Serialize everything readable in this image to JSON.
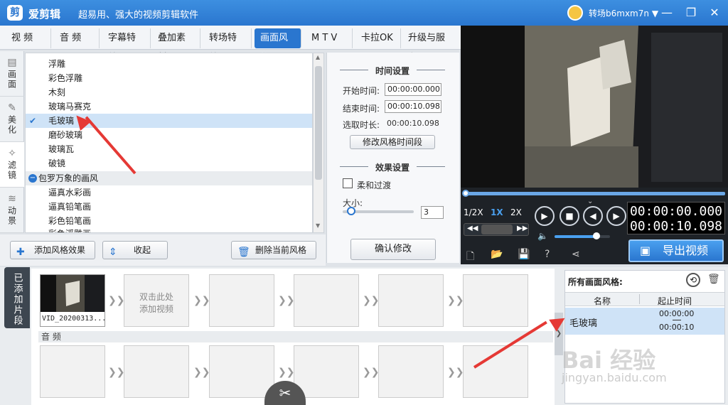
{
  "titlebar": {
    "app_name": "爱剪辑",
    "logo": "剪",
    "slogan": "超易用、强大的视频剪辑软件",
    "user_name": "转场b6mxm7n",
    "chevron": "▼"
  },
  "tabs": [
    {
      "label": "视 频"
    },
    {
      "label": "音 频"
    },
    {
      "label": "字幕特效"
    },
    {
      "label": "叠加素材"
    },
    {
      "label": "转场特效"
    },
    {
      "label": "画面风格"
    },
    {
      "label": "M T V"
    },
    {
      "label": "卡拉OK"
    },
    {
      "label": "升级与服务"
    }
  ],
  "side_tabs": [
    {
      "label": "画面"
    },
    {
      "label": "美化"
    },
    {
      "label": "滤镜"
    },
    {
      "label": "动景"
    }
  ],
  "filter_items": [
    "浮雕",
    "彩色浮雕",
    "木刻",
    "玻璃马赛克",
    "毛玻璃",
    "磨砂玻璃",
    "玻璃瓦",
    "破镜"
  ],
  "filter_group": "包罗万象的画风",
  "group_items": [
    "逼真水彩画",
    "逼真铅笔画",
    "彩色铅笔画",
    "彩色浮雕画"
  ],
  "settings": {
    "time_title": "时间设置",
    "start_label": "开始时间:",
    "start_value": "00:00:00.000",
    "end_label": "结束时间:",
    "end_value": "00:00:10.098",
    "duration_label": "选取时长:",
    "duration_value": "00:00:10.098",
    "modify_time_btn": "修改风格时间段",
    "effect_title": "效果设置",
    "soft_transition": "柔和过渡",
    "size_label": "大小:",
    "size_value": "3",
    "confirm_btn": "确认修改"
  },
  "toolbar": {
    "add_effect": "添加风格效果",
    "collapse": "收起",
    "delete_style": "删除当前风格"
  },
  "player": {
    "speeds": [
      "1/2X",
      "1X",
      "2X"
    ],
    "time_current": "00:00:00.000",
    "time_total": "00:00:10.098",
    "export": "导出视频",
    "volume": 0.75
  },
  "timeline": {
    "added_label": "已添加片段",
    "clip_name": "VID_20200313...",
    "placeholder": "双击此处\n添加视频",
    "audio_label": "音 频"
  },
  "style_panel": {
    "title": "所有画面风格:",
    "col_name": "名称",
    "col_time": "起止时间",
    "row": {
      "name": "毛玻璃",
      "start": "00:00:00",
      "end": "00:00:10"
    }
  },
  "watermark": {
    "text": "Bai 经验",
    "url": "jingyan.baidu.com"
  },
  "colors": {
    "accent": "#2a76cf",
    "selection": "#cfe3f7",
    "annotation": "#e53935"
  }
}
